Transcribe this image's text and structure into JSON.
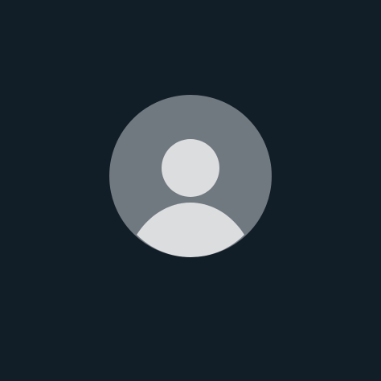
{
  "avatar": {
    "icon": "default-user-silhouette-icon",
    "alt": "User avatar",
    "colors": {
      "background": "#121e27",
      "circle": "#707880",
      "figure": "#dcdddf"
    }
  }
}
